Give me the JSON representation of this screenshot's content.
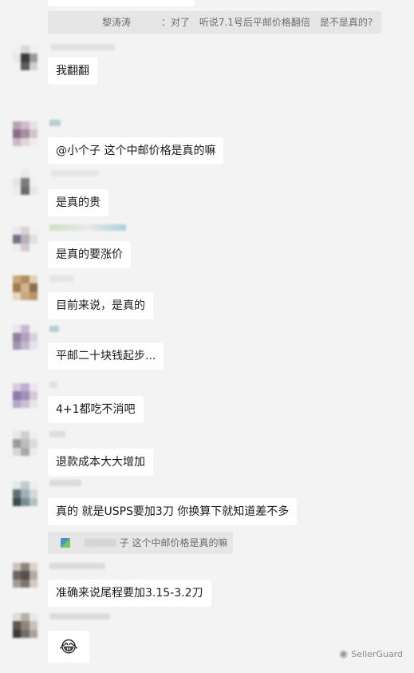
{
  "quote_top": {
    "name": "黎涛涛",
    "text": "：对了　听说7.1号后平邮价格翻倍　是不是真的?"
  },
  "messages": [
    {
      "text": "我翻翻"
    },
    {
      "text": "@小个子 这个中邮价格是真的嘛"
    },
    {
      "text": "是真的贵"
    },
    {
      "text": "是真的要涨价"
    },
    {
      "text": "目前来说，是真的"
    },
    {
      "text": "平邮二十块钱起步..."
    },
    {
      "text": "4+1都吃不消吧"
    },
    {
      "text": "退款成本大大增加"
    },
    {
      "text": "真的 就是USPS要加3刀 你换算下就知道差不多"
    },
    {
      "text": "准确来说尾程要加3.15-3.2刀"
    }
  ],
  "quote_bottom": {
    "text": "子  这个中邮价格是真的嘛"
  },
  "emoji": {
    "name": "laughing-tears-icon",
    "glyph": "😂"
  },
  "watermark": {
    "text": "SellerGuard"
  }
}
